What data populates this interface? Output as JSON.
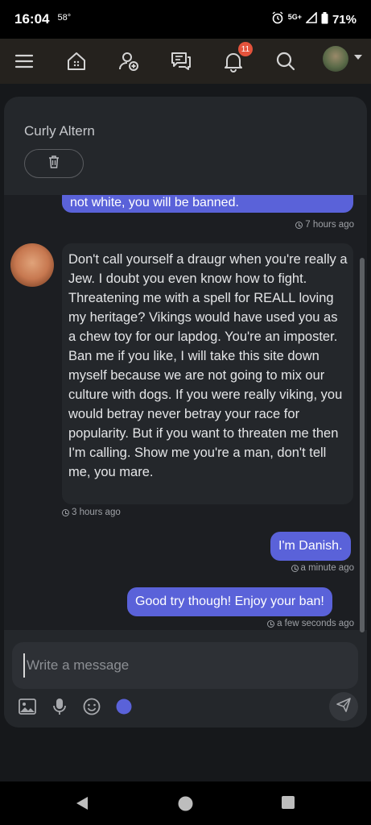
{
  "status_bar": {
    "time": "16:04",
    "temperature": "58°",
    "network": "5G+",
    "battery": "71%"
  },
  "navbar": {
    "icons": [
      "menu-icon",
      "home-icon",
      "add-user-icon",
      "messages-icon",
      "bell-icon",
      "search-icon",
      "avatar"
    ],
    "notification_count": "11"
  },
  "chat": {
    "name": "Curly Altern",
    "messages": [
      {
        "direction": "out",
        "text": "not white, you will be banned.",
        "time": "7 hours ago"
      },
      {
        "direction": "in",
        "text": "Don't call yourself a draugr when you're really a Jew. I doubt you even know how to fight. Threatening me with a spell for REALL loving my heritage? Vikings would have used you as a chew toy for our lapdog. You're an imposter. Ban me if you like, I will take this site down myself because we are not going to mix our culture with dogs. If you were really viking, you would betray never betray your race for popularity. But if you want to threaten me then I'm calling. Show me you're a man, don't tell me, you mare.",
        "time": "3 hours ago"
      },
      {
        "direction": "out",
        "text": "I'm Danish.",
        "time": "a minute ago"
      },
      {
        "direction": "out",
        "text": "Good try though! Enjoy your ban!",
        "time": "a few seconds ago"
      }
    ]
  },
  "composer": {
    "placeholder": "Write a message",
    "tools": [
      "image-icon",
      "microphone-icon",
      "emoji-icon",
      "color-icon"
    ],
    "accent_color": "#5a62d9"
  },
  "colors": {
    "outgoing_bubble": "#5a62d9",
    "panel": "#24272b",
    "badge": "#e5533c"
  }
}
